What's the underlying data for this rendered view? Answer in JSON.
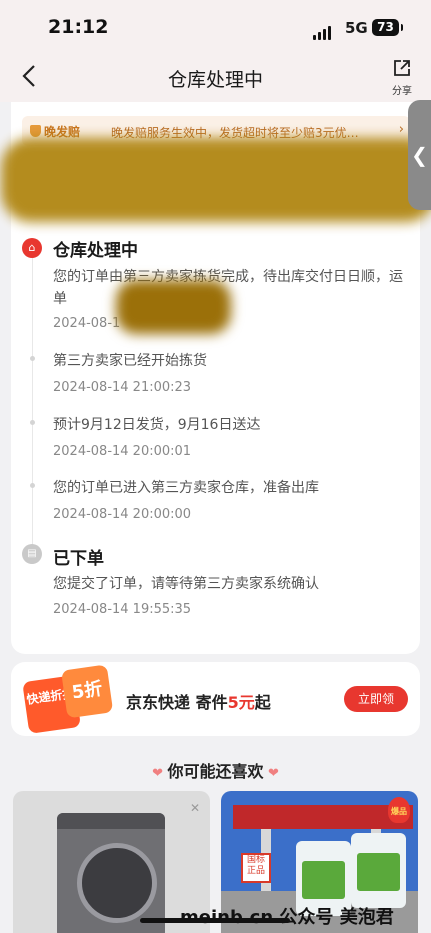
{
  "status_bar": {
    "time": "21:12",
    "network": "5G",
    "battery": "73"
  },
  "nav": {
    "title": "仓库处理中",
    "share_label": "分享"
  },
  "notice": {
    "tag": "晚发赔",
    "message": "晚发赔服务生效中，发货超时将至少赔3元优…"
  },
  "timeline": [
    {
      "title": "仓库处理中",
      "text": "您的订单由第三方卖家拣货完成，待出库交付日日顺，运单",
      "date": "2024-08-1"
    },
    {
      "text": "第三方卖家已经开始拣货",
      "date": "2024-08-14 21:00:23"
    },
    {
      "text": "预计9月12日发货，9月16日送达",
      "date": "2024-08-14 20:00:01"
    },
    {
      "text": "您的订单已进入第三方卖家仓库，准备出库",
      "date": "2024-08-14 20:00:00"
    },
    {
      "title": "已下单",
      "text": "您提交了订单，请等待第三方卖家系统确认",
      "date": "2024-08-14 19:55:35"
    }
  ],
  "promo": {
    "badge_text": "快递折扣",
    "badge_value": "5折",
    "text_prefix": "京东快递 寄件",
    "text_amount": "5元",
    "text_suffix": "起",
    "button": "立即领"
  },
  "recommend": {
    "title": "你可能还喜欢"
  },
  "products": [
    {
      "icon": "washing-machine"
    },
    {
      "icon": "antifreeze-jugs",
      "stamp": "国标正品",
      "badge": "爆品"
    }
  ],
  "watermark": "meinb.cn 公众号 美泡君",
  "colors": {
    "accent": "#e8372f",
    "notice_bg": "#fbf0e6",
    "notice_text": "#b86a23"
  }
}
